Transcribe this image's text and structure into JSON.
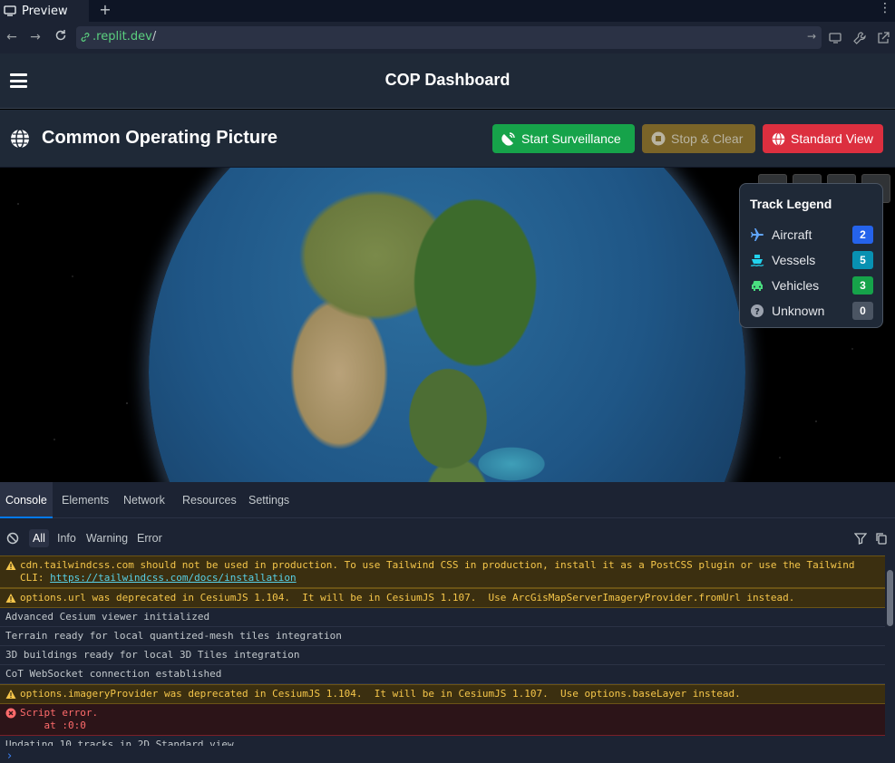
{
  "browser": {
    "tab_label": "Preview",
    "new_tab": "+",
    "menu": "⋮",
    "url_domain": ".replit.dev",
    "url_path": "/"
  },
  "app": {
    "nav_title": "COP Dashboard",
    "page_title": "Common Operating Picture",
    "buttons": {
      "start": "Start Surveillance",
      "stop": "Stop & Clear",
      "standard": "Standard View"
    },
    "legend": {
      "title": "Track Legend",
      "items": [
        {
          "label": "Aircraft",
          "count": "2",
          "color": "#2563eb",
          "icon": "plane-icon"
        },
        {
          "label": "Vessels",
          "count": "5",
          "color": "#0891b2",
          "icon": "ship-icon"
        },
        {
          "label": "Vehicles",
          "count": "3",
          "color": "#16a34a",
          "icon": "car-icon"
        },
        {
          "label": "Unknown",
          "count": "0",
          "color": "#4b5563",
          "icon": "question-icon"
        }
      ]
    }
  },
  "devtools": {
    "tabs": [
      "Console",
      "Elements",
      "Network",
      "Resources",
      "Settings"
    ],
    "filters": [
      "All",
      "Info",
      "Warning",
      "Error"
    ],
    "logs": [
      {
        "type": "warn",
        "text": "cdn.tailwindcss.com should not be used in production. To use Tailwind CSS in production, install it as a PostCSS plugin or use the Tailwind\nCLI: ",
        "link": "https://tailwindcss.com/docs/installation"
      },
      {
        "type": "warn",
        "text": "options.url was deprecated in CesiumJS 1.104.  It will be in CesiumJS 1.107.  Use ArcGisMapServerImageryProvider.fromUrl instead."
      },
      {
        "type": "plain",
        "text": "Advanced Cesium viewer initialized"
      },
      {
        "type": "plain",
        "text": "Terrain ready for local quantized-mesh tiles integration"
      },
      {
        "type": "plain",
        "text": "3D buildings ready for local 3D Tiles integration"
      },
      {
        "type": "plain",
        "text": "CoT WebSocket connection established"
      },
      {
        "type": "warn",
        "text": "options.imageryProvider was deprecated in CesiumJS 1.104.  It will be in CesiumJS 1.107.  Use options.baseLayer instead."
      },
      {
        "type": "err",
        "text": "Script error.\n    at :0:0"
      },
      {
        "type": "plain",
        "text": "Updating 10 tracks in 2D Standard view"
      }
    ]
  }
}
